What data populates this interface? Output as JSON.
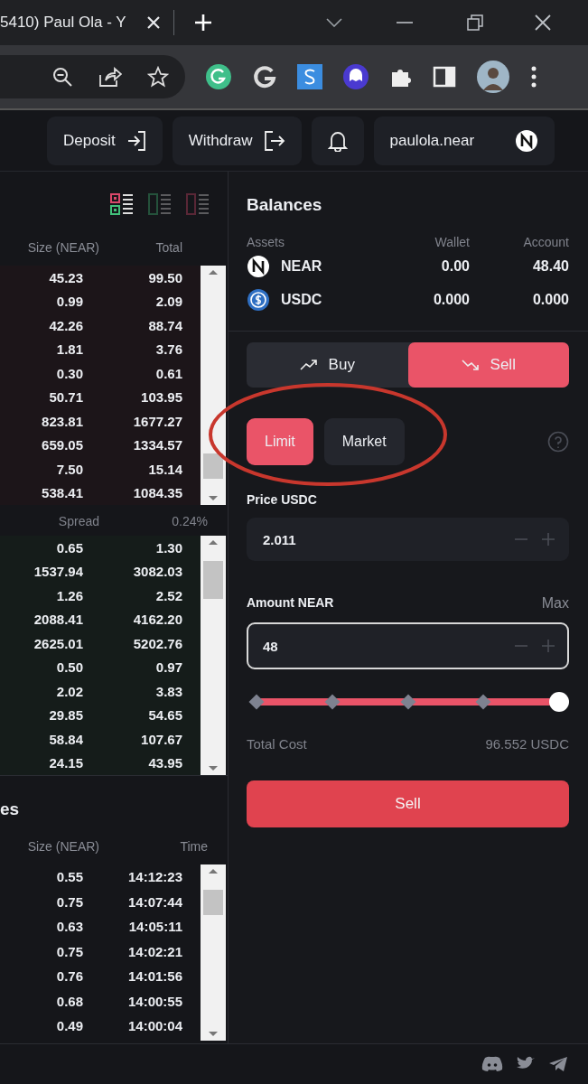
{
  "browser": {
    "tab_title": "5410) Paul Ola - Y"
  },
  "header": {
    "deposit": "Deposit",
    "withdraw": "Withdraw",
    "account": "paulola.near"
  },
  "orderbook": {
    "view_modes": [
      {
        "kind": "both",
        "selected": true
      },
      {
        "kind": "bids",
        "selected": false
      },
      {
        "kind": "asks",
        "selected": false
      }
    ],
    "columns": [
      "Size (NEAR)",
      "Total"
    ],
    "asks": [
      {
        "size": "45.23",
        "total": "99.50"
      },
      {
        "size": "0.99",
        "total": "2.09"
      },
      {
        "size": "42.26",
        "total": "88.74"
      },
      {
        "size": "1.81",
        "total": "3.76"
      },
      {
        "size": "0.30",
        "total": "0.61"
      },
      {
        "size": "50.71",
        "total": "103.95"
      },
      {
        "size": "823.81",
        "total": "1677.27"
      },
      {
        "size": "659.05",
        "total": "1334.57"
      },
      {
        "size": "7.50",
        "total": "15.14"
      },
      {
        "size": "538.41",
        "total": "1084.35"
      }
    ],
    "spread_label": "Spread",
    "spread_value": "0.24%",
    "bids": [
      {
        "size": "0.65",
        "total": "1.30"
      },
      {
        "size": "1537.94",
        "total": "3082.03"
      },
      {
        "size": "1.26",
        "total": "2.52"
      },
      {
        "size": "2088.41",
        "total": "4162.20"
      },
      {
        "size": "2625.01",
        "total": "5202.76"
      },
      {
        "size": "0.50",
        "total": "0.97"
      },
      {
        "size": "2.02",
        "total": "3.83"
      },
      {
        "size": "29.85",
        "total": "54.65"
      },
      {
        "size": "58.84",
        "total": "107.67"
      },
      {
        "size": "24.15",
        "total": "43.95"
      }
    ]
  },
  "trades": {
    "title": "es",
    "columns": [
      "Size (NEAR)",
      "Time"
    ],
    "rows": [
      {
        "size": "0.55",
        "time": "14:12:23"
      },
      {
        "size": "0.75",
        "time": "14:07:44"
      },
      {
        "size": "0.63",
        "time": "14:05:11"
      },
      {
        "size": "0.75",
        "time": "14:02:21"
      },
      {
        "size": "0.76",
        "time": "14:01:56"
      },
      {
        "size": "0.68",
        "time": "14:00:55"
      },
      {
        "size": "0.49",
        "time": "14:00:04"
      }
    ]
  },
  "balances": {
    "title": "Balances",
    "columns": [
      "Assets",
      "Wallet",
      "Account"
    ],
    "rows": [
      {
        "kind": "near",
        "asset": "NEAR",
        "wallet": "0.00",
        "account": "48.40"
      },
      {
        "kind": "usdc",
        "asset": "USDC",
        "wallet": "0.000",
        "account": "0.000"
      }
    ]
  },
  "order": {
    "sides": [
      {
        "kind": "buy",
        "label": "Buy",
        "selected": false
      },
      {
        "kind": "sell",
        "label": "Sell",
        "selected": true
      }
    ],
    "types": [
      {
        "label": "Limit",
        "selected": true
      },
      {
        "label": "Market",
        "selected": false
      }
    ],
    "price_label": "Price USDC",
    "price": "2.011",
    "amount_label": "Amount NEAR",
    "max": "Max",
    "amount": "48",
    "amount_focused": true,
    "level": 1,
    "total_label": "Total Cost",
    "total": "96.552 USDC",
    "submit": "Sell"
  }
}
